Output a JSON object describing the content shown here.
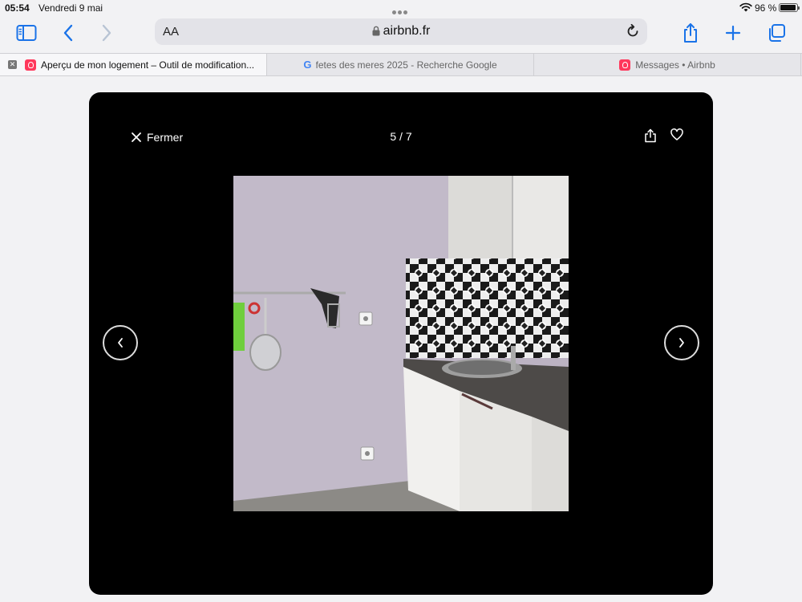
{
  "status_bar": {
    "time": "05:54",
    "date": "Vendredi 9 mai",
    "battery": "96 %",
    "battery_level": 0.96
  },
  "toolbar": {
    "reader_label": "AA",
    "url": "airbnb.fr",
    "icons": [
      "sidebar-icon",
      "back-icon",
      "forward-icon",
      "lock-icon",
      "reload-icon",
      "share-icon",
      "new-tab-icon",
      "tabs-overview-icon"
    ]
  },
  "tabs": [
    {
      "title": "Aperçu de mon logement – Outil de modification...",
      "favicon": "airbnb-favicon",
      "active": true
    },
    {
      "title": "fetes des meres 2025 - Recherche Google",
      "favicon": "google-favicon",
      "active": false
    },
    {
      "title": "Messages • Airbnb",
      "favicon": "airbnb-favicon",
      "active": false
    }
  ],
  "google_glyph": "G",
  "viewer": {
    "close_label": "Fermer",
    "counter": "5 / 7",
    "photo_description": "kitchen-photo"
  },
  "colors": {
    "accent": "#1a73e8",
    "airbnb": "#ff385c",
    "viewer_bg": "#000000"
  }
}
